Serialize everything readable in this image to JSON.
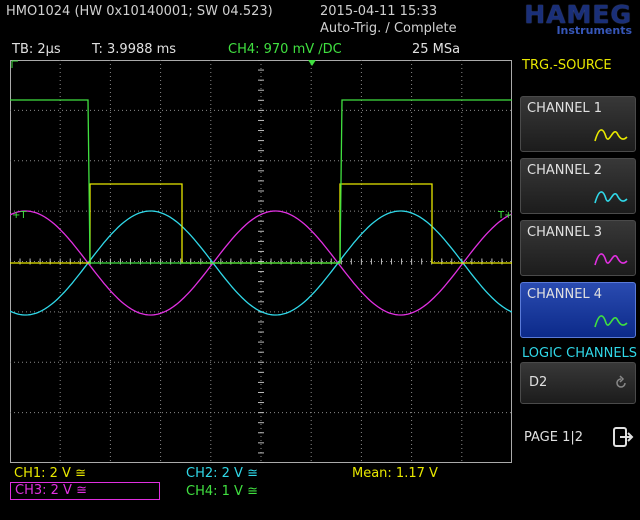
{
  "header": {
    "device": "HMO1024 (HW 0x10140001; SW 04.523)",
    "datetime": "2015-04-11 15:33",
    "status": "Auto-Trig. / Complete",
    "brand": "HAMEG",
    "brand_sub": "Instruments"
  },
  "info": {
    "timebase": "TB: 2µs",
    "trigger_time": "T: 3.9988 ms",
    "channel_info": "CH4: 970 mV ∕DC",
    "sample_rate": "25 MSa"
  },
  "sidebar": {
    "title": "TRG.-SOURCE",
    "channels": [
      {
        "label": "CHANNEL 1",
        "color": "#e8e800"
      },
      {
        "label": "CHANNEL 2",
        "color": "#30d8e8"
      },
      {
        "label": "CHANNEL 3",
        "color": "#e030e0"
      },
      {
        "label": "CHANNEL 4",
        "color": "#40e040"
      }
    ],
    "active_channel": "CHANNEL 4",
    "logic_title": "LOGIC CHANNELS",
    "logic_item": "D2",
    "page": "PAGE 1|2"
  },
  "bottom": {
    "ch1": "CH1: 2 V ≅",
    "ch2": "CH2: 2 V ≅",
    "ch3": "CH3: 2 V ≅",
    "ch4": "CH4: 1 V ≅",
    "measurement": "Mean: 1.17 V"
  },
  "colors": {
    "ch1": "#e8e800",
    "ch2": "#30d8e8",
    "ch3": "#e030e0",
    "ch4": "#40e040",
    "accent_blue": "#0c2a8a",
    "grid": "#9a9a9a"
  }
}
